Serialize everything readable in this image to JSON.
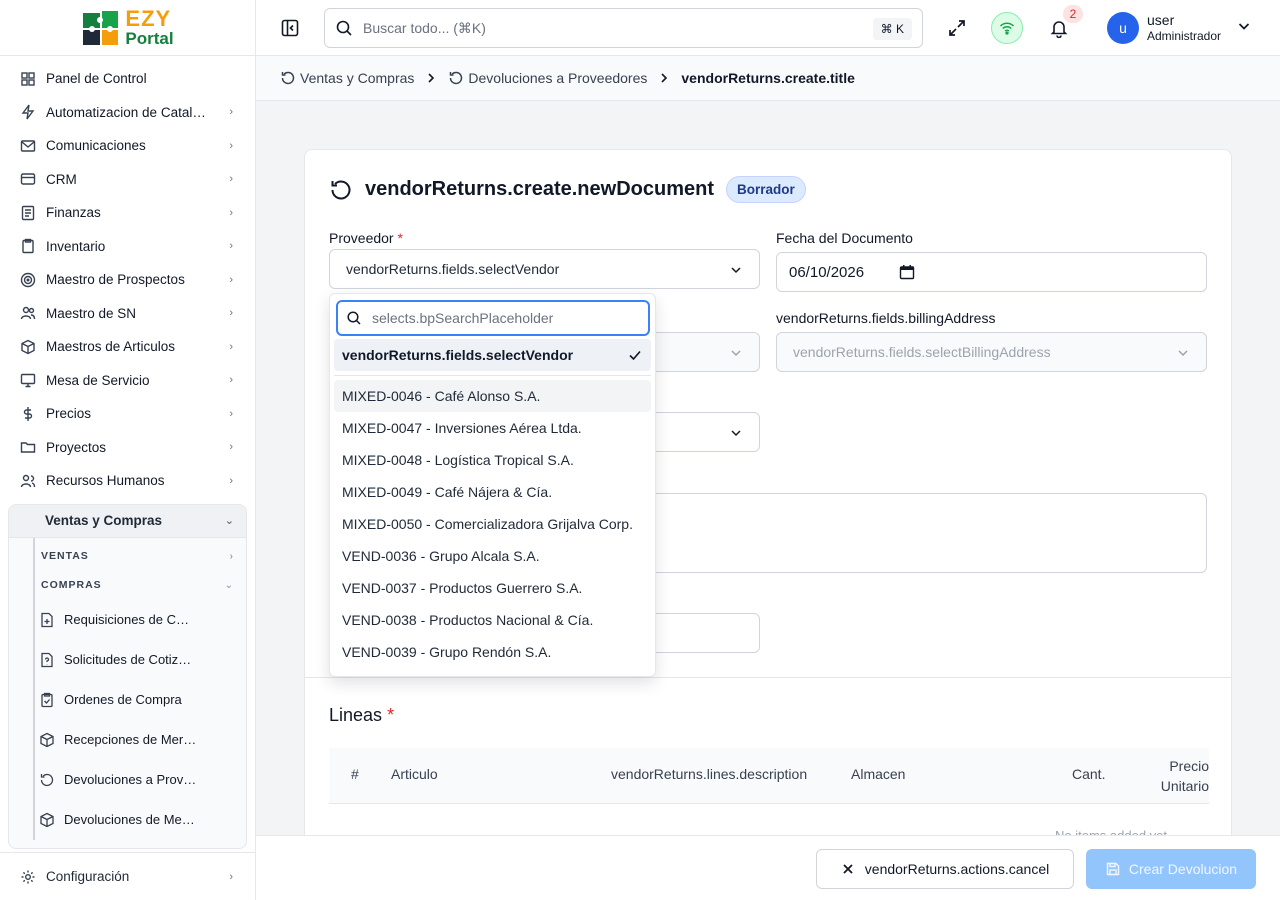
{
  "brand": {
    "logo_primary": "EZY",
    "logo_secondary": "Portal",
    "color_primary": "#f59e0b",
    "color_secondary": "#15803d"
  },
  "sidebar": {
    "items": [
      {
        "label": "Panel de Control",
        "icon": "dashboard-icon",
        "expandable": false
      },
      {
        "label": "Automatizacion de Catalogo",
        "icon": "zap-icon",
        "expandable": true
      },
      {
        "label": "Comunicaciones",
        "icon": "mail-icon",
        "expandable": true
      },
      {
        "label": "CRM",
        "icon": "credit-card-icon",
        "expandable": true
      },
      {
        "label": "Finanzas",
        "icon": "ledger-icon",
        "expandable": true
      },
      {
        "label": "Inventario",
        "icon": "clipboard-icon",
        "expandable": true
      },
      {
        "label": "Maestro de Prospectos",
        "icon": "target-icon",
        "expandable": true
      },
      {
        "label": "Maestro de SN",
        "icon": "users-icon",
        "expandable": true
      },
      {
        "label": "Maestros de Articulos",
        "icon": "package-icon",
        "expandable": true
      },
      {
        "label": "Mesa de Servicio",
        "icon": "monitor-icon",
        "expandable": true
      },
      {
        "label": "Precios",
        "icon": "dollar-icon",
        "expandable": true
      },
      {
        "label": "Proyectos",
        "icon": "folder-icon",
        "expandable": true
      },
      {
        "label": "Recursos Humanos",
        "icon": "user-group-icon",
        "expandable": true
      }
    ],
    "active_group": {
      "label": "Ventas y Compras",
      "sections": [
        {
          "label": "VENTAS",
          "expanded": false
        },
        {
          "label": "COMPRAS",
          "expanded": true
        }
      ],
      "sub_items": [
        {
          "label": "Requisiciones de Compra",
          "icon": "file-plus-icon"
        },
        {
          "label": "Solicitudes de Cotizacion",
          "icon": "file-question-icon"
        },
        {
          "label": "Ordenes de Compra",
          "icon": "clipboard-check-icon"
        },
        {
          "label": "Recepciones de Mercancia",
          "icon": "package-icon"
        },
        {
          "label": "Devoluciones a Proveedores",
          "icon": "rotate-ccw-icon"
        },
        {
          "label": "Devoluciones de Mercancia",
          "icon": "package-return-icon"
        }
      ]
    },
    "bottom": {
      "label": "Configuración",
      "icon": "gear-icon"
    }
  },
  "topbar": {
    "search_placeholder": "Buscar todo... (⌘K)",
    "search_shortcut": "⌘ K",
    "notification_count": "2",
    "user_initial": "u",
    "user_name": "user",
    "user_role": "Administrador"
  },
  "breadcrumb": {
    "items": [
      {
        "label": "Ventas y Compras"
      },
      {
        "label": "Devoluciones a Proveedores"
      },
      {
        "label": "vendorReturns.create.title"
      }
    ]
  },
  "form": {
    "title": "vendorReturns.create.newDocument",
    "status": "Borrador",
    "vendor_label": "Proveedor",
    "vendor_value": "vendorReturns.fields.selectVendor",
    "date_label": "Fecha del Documento",
    "date_value": "06/10/2026",
    "billing_label": "vendorReturns.fields.billingAddress",
    "billing_value": "vendorReturns.fields.selectBillingAddress",
    "required_marker": "*"
  },
  "dropdown": {
    "search_placeholder": "selects.bpSearchPlaceholder",
    "selected": "vendorReturns.fields.selectVendor",
    "options": [
      "MIXED-0046 - Café Alonso S.A.",
      "MIXED-0047 - Inversiones Aérea Ltda.",
      "MIXED-0048 - Logística Tropical S.A.",
      "MIXED-0049 - Café Nájera & Cía.",
      "MIXED-0050 - Comercializadora Grijalva Corp.",
      "VEND-0036 - Grupo Alcala S.A.",
      "VEND-0037 - Productos Guerrero S.A.",
      "VEND-0038 - Productos Nacional & Cía.",
      "VEND-0039 - Grupo Rendón S.A."
    ]
  },
  "lines": {
    "title": "Lineas",
    "columns": [
      "#",
      "Articulo",
      "vendorReturns.lines.description",
      "Almacen",
      "Cant.",
      "Precio Unitario"
    ],
    "empty": "No items added yet"
  },
  "footer": {
    "cancel_label": "vendorReturns.actions.cancel",
    "create_label": "Crear Devolucion"
  },
  "colors": {
    "accent": "#3b82f6",
    "create_disabled": "#93c5fd",
    "required": "#dc2626"
  }
}
